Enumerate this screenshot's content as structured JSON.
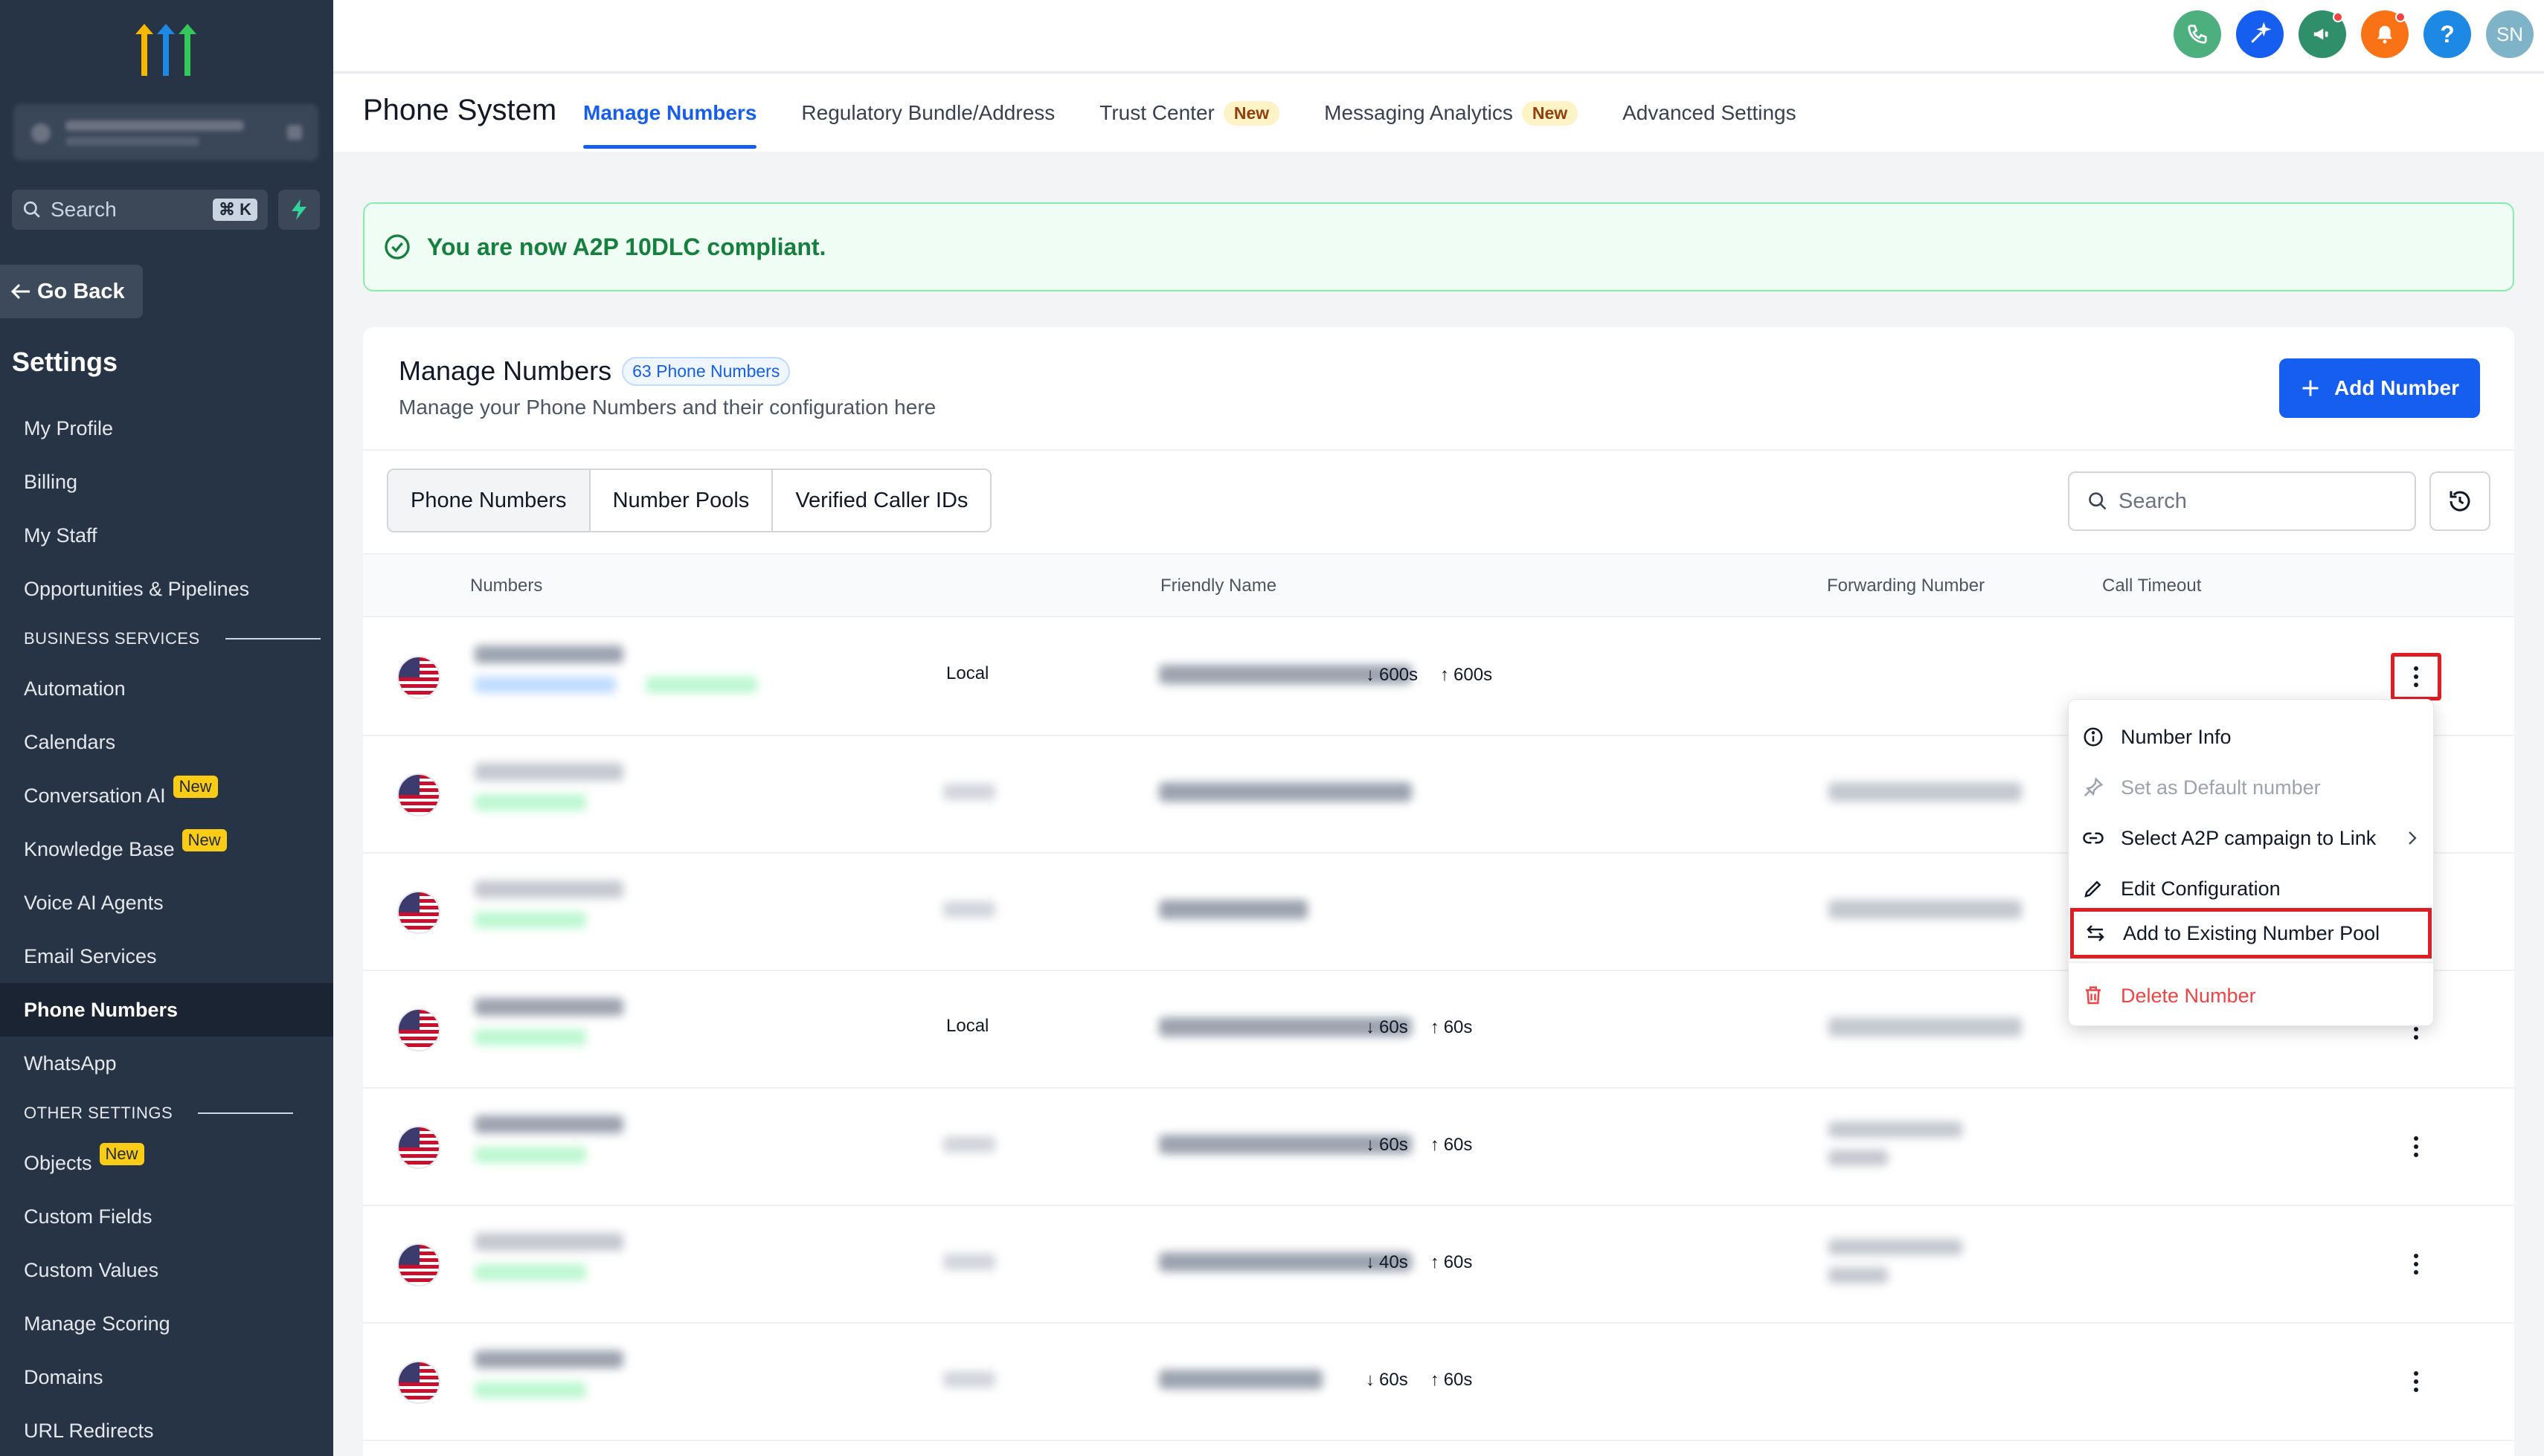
{
  "sidebar": {
    "search_placeholder": "Search",
    "search_shortcut": "⌘ K",
    "go_back": "Go Back",
    "settings_title": "Settings",
    "items": [
      {
        "label": "My Profile"
      },
      {
        "label": "Billing"
      },
      {
        "label": "My Staff"
      },
      {
        "label": "Opportunities & Pipelines"
      }
    ],
    "section_business": "BUSINESS SERVICES",
    "business_items": [
      {
        "label": "Automation",
        "badge": ""
      },
      {
        "label": "Calendars",
        "badge": ""
      },
      {
        "label": "Conversation AI",
        "badge": "New"
      },
      {
        "label": "Knowledge Base",
        "badge": "New"
      },
      {
        "label": "Voice AI Agents",
        "badge": ""
      },
      {
        "label": "Email Services",
        "badge": ""
      },
      {
        "label": "Phone Numbers",
        "badge": "",
        "active": true
      },
      {
        "label": "WhatsApp",
        "badge": ""
      }
    ],
    "section_other": "OTHER SETTINGS",
    "other_items": [
      {
        "label": "Objects",
        "badge": "New"
      },
      {
        "label": "Custom Fields",
        "badge": ""
      },
      {
        "label": "Custom Values",
        "badge": ""
      },
      {
        "label": "Manage Scoring",
        "badge": ""
      },
      {
        "label": "Domains",
        "badge": ""
      },
      {
        "label": "URL Redirects",
        "badge": ""
      }
    ]
  },
  "topbar": {
    "icons": [
      "phone-icon",
      "magic-wand-icon",
      "megaphone-icon",
      "bell-icon",
      "help-icon",
      "avatar"
    ],
    "help_label": "?",
    "avatar_initials": "SN",
    "colors": {
      "phone": "#4caf7d",
      "wand": "#155eef",
      "megaphone": "#2f8f6a",
      "bell": "#f97316",
      "help": "#1e88e5",
      "avatar": "#7fb3c8"
    }
  },
  "header": {
    "title": "Phone System",
    "tabs": [
      {
        "label": "Manage Numbers",
        "active": true,
        "badge": ""
      },
      {
        "label": "Regulatory Bundle/Address",
        "badge": ""
      },
      {
        "label": "Trust Center",
        "badge": "New"
      },
      {
        "label": "Messaging Analytics",
        "badge": "New"
      },
      {
        "label": "Advanced Settings",
        "badge": ""
      }
    ]
  },
  "banner": {
    "text": "You are now A2P 10DLC compliant."
  },
  "card": {
    "title": "Manage Numbers",
    "count": "63 Phone Numbers",
    "subtitle": "Manage your Phone Numbers and their configuration here",
    "add_button": "Add Number",
    "segments": [
      "Phone Numbers",
      "Number Pools",
      "Verified Caller IDs"
    ],
    "search_placeholder": "Search",
    "columns": {
      "numbers": "Numbers",
      "friendly": "Friendly Name",
      "forwarding": "Forwarding Number",
      "timeout": "Call Timeout"
    }
  },
  "rows": [
    {
      "type": "Local",
      "in": "600s",
      "out": "600s"
    },
    {
      "type": "",
      "in": "",
      "out": ""
    },
    {
      "type": "",
      "in": "",
      "out": ""
    },
    {
      "type": "Local",
      "in": "60s",
      "out": "60s"
    },
    {
      "type": "",
      "in": "60s",
      "out": "60s"
    },
    {
      "type": "",
      "in": "40s",
      "out": "60s"
    },
    {
      "type": "",
      "in": "60s",
      "out": "60s"
    }
  ],
  "menu": {
    "items": [
      {
        "label": "Number Info",
        "icon": "info-icon"
      },
      {
        "label": "Set as Default number",
        "icon": "pin-icon",
        "disabled": true
      },
      {
        "label": "Select A2P campaign to Link",
        "icon": "link-icon"
      },
      {
        "label": "Edit Configuration",
        "icon": "pencil-icon"
      },
      {
        "label": "Add to Existing Number Pool",
        "icon": "swap-icon",
        "highlighted": true
      },
      {
        "label": "Delete Number",
        "icon": "trash-icon",
        "danger": true
      }
    ]
  },
  "colors": {
    "accent": "#155eef",
    "sidebar": "#273446",
    "success": "#15803d",
    "danger": "#ef4444",
    "highlight_box": "#e11d24"
  }
}
